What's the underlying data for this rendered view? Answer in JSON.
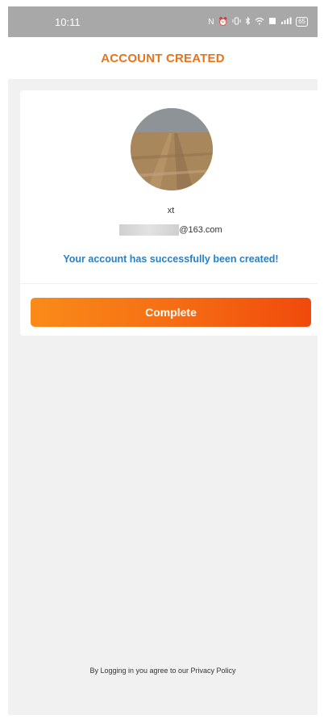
{
  "status_bar": {
    "time": "10:11",
    "battery_level": "65",
    "icons": [
      "nfc-icon",
      "alarm-icon",
      "vibrate-icon",
      "bluetooth-icon",
      "wifi-icon",
      "sim-icon",
      "signal-icon",
      "battery-icon"
    ]
  },
  "header": {
    "title": "ACCOUNT CREATED"
  },
  "account": {
    "username": "xt",
    "email_domain": "@163.com",
    "success_message": "Your account has successfully been created!"
  },
  "actions": {
    "complete_label": "Complete"
  },
  "footer": {
    "text": "By Logging in you agree to our Privacy Policy"
  },
  "colors": {
    "accent": "#e8731a",
    "success_text": "#2680c8",
    "button_gradient_start": "#f98b19",
    "button_gradient_end": "#f04a0c",
    "background": "#f1f1f1"
  }
}
